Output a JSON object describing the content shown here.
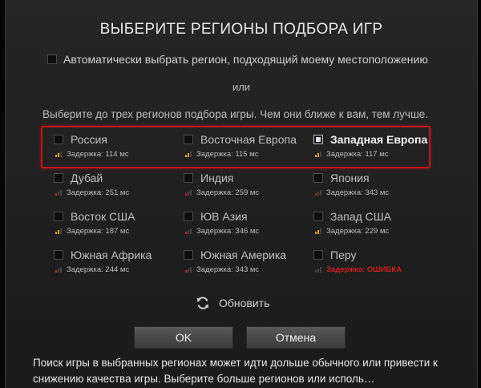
{
  "dialog": {
    "title": "ВЫБЕРИТЕ РЕГИОНЫ ПОДБОРА ИГР",
    "auto_select_label": "Автоматически выбрать регион, подходящий моему местоположению",
    "or_label": "или",
    "hint": "Выберите до трех регионов подбора игры. Чем они ближе к вам, тем лучше.",
    "regions": [
      {
        "name": "Россия",
        "latency": "Задержка: 114 мс",
        "selected": false,
        "signal": 2,
        "signal_color": "#d9a21a",
        "error": false
      },
      {
        "name": "Восточная Европа",
        "latency": "Задержка: 115 мс",
        "selected": false,
        "signal": 2,
        "signal_color": "#d9a21a",
        "error": false
      },
      {
        "name": "Западная Европа",
        "latency": "Задержка: 117 мс",
        "selected": true,
        "signal": 2,
        "signal_color": "#d9a21a",
        "error": false
      },
      {
        "name": "Дубай",
        "latency": "Задержка: 251 мс",
        "selected": false,
        "signal": 1,
        "signal_color": "#c0251d",
        "error": false
      },
      {
        "name": "Индия",
        "latency": "Задержка: 259 мс",
        "selected": false,
        "signal": 1,
        "signal_color": "#c0251d",
        "error": false
      },
      {
        "name": "Япония",
        "latency": "Задержка: 343 мс",
        "selected": false,
        "signal": 1,
        "signal_color": "#c0251d",
        "error": false
      },
      {
        "name": "Восток США",
        "latency": "Задержка: 187 мс",
        "selected": false,
        "signal": 2,
        "signal_color": "#d9a21a",
        "error": false
      },
      {
        "name": "ЮВ Азия",
        "latency": "Задержка: 346 мс",
        "selected": false,
        "signal": 1,
        "signal_color": "#c0251d",
        "error": false
      },
      {
        "name": "Запад США",
        "latency": "Задержка: 229 мс",
        "selected": false,
        "signal": 2,
        "signal_color": "#d9a21a",
        "error": false
      },
      {
        "name": "Южная Африка",
        "latency": "Задержка: 244 мс",
        "selected": false,
        "signal": 1,
        "signal_color": "#c0251d",
        "error": false
      },
      {
        "name": "Южная Америка",
        "latency": "Задержка: 343 мс",
        "selected": false,
        "signal": 1,
        "signal_color": "#c0251d",
        "error": false
      },
      {
        "name": "Перу",
        "latency": "Задержка: ОШИБКА",
        "selected": false,
        "signal": 0,
        "signal_color": "#444444",
        "error": true
      }
    ],
    "refresh_label": "Обновить",
    "ok_label": "OK",
    "cancel_label": "Отмена",
    "footer": "Поиск игры в выбранных регионах может идти дольше обычного или привести к снижению качества игры. Выберите больше регионов или исполь…"
  },
  "colors": {
    "highlight_border": "#c0161c",
    "error_text": "#d11d1d",
    "signal_good": "#d9a21a",
    "signal_bad": "#c0251d"
  }
}
